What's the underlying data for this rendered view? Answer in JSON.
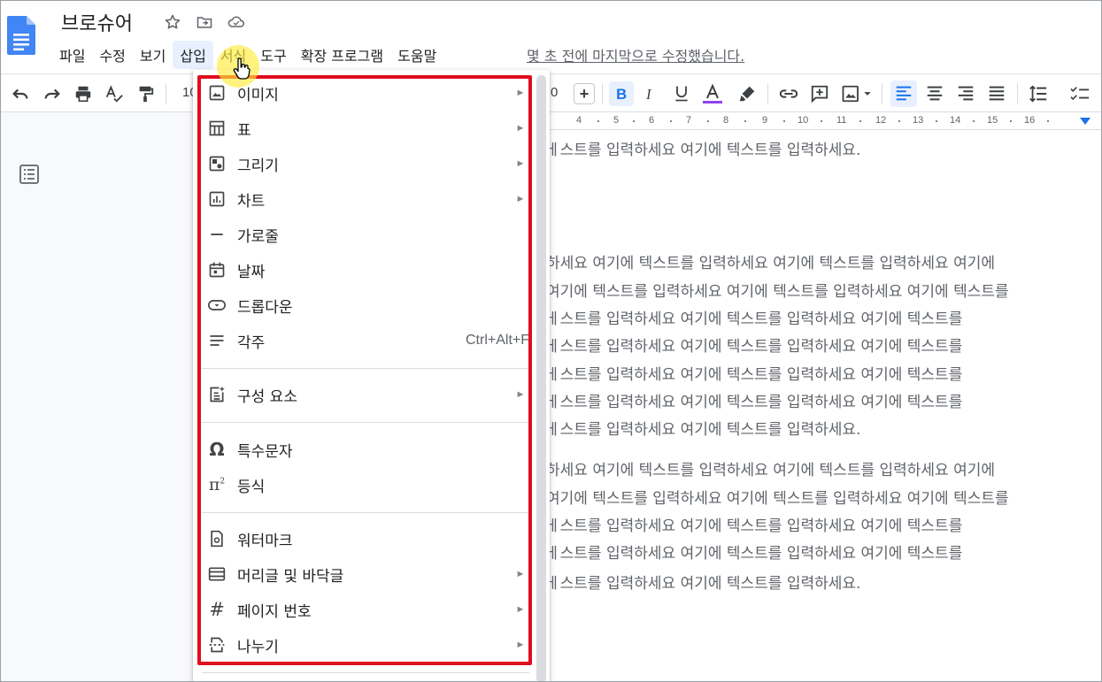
{
  "app": {
    "doc_title": "브로슈어",
    "last_edit": "몇 초 전에 마지막으로 수정했습니다."
  },
  "menubar": [
    "파일",
    "수정",
    "보기",
    "삽입",
    "서식",
    "도구",
    "확장 프로그램",
    "도움말"
  ],
  "toolbar": {
    "font_size_partial": "10",
    "font_size_tail": "0",
    "plus": "+",
    "text_color_accent": "#8e44ef"
  },
  "ruler": [
    "4",
    "5",
    "6",
    "7",
    "8",
    "9",
    "10",
    "11",
    "12",
    "13",
    "14",
    "15",
    "16"
  ],
  "document": {
    "lines": [
      "ㅔ스트를 입력하세요 여기에 텍스트를 입력하세요.",
      "하세요 여기에 텍스트를 입력하세요 여기에 텍스트를 입력하세요 여기에",
      "여기에 텍스트를 입력하세요 여기에 텍스트를 입력하세요 여기에 텍스트를",
      "ㅔ스트를 입력하세요 여기에 텍스트를 입력하세요 여기에 텍스트를",
      "ㅔ스트를 입력하세요 여기에 텍스트를 입력하세요 여기에 텍스트를",
      "ㅔ스트를 입력하세요 여기에 텍스트를 입력하세요 여기에 텍스트를",
      "ㅔ스트를 입력하세요 여기에 텍스트를 입력하세요 여기에 텍스트를",
      "ㅔ스트를 입력하세요 여기에 텍스트를 입력하세요.",
      "하세요 여기에 텍스트를 입력하세요 여기에 텍스트를 입력하세요 여기에",
      "여기에 텍스트를 입력하세요 여기에 텍스트를 입력하세요 여기에 텍스트를",
      "ㅔ스트를 입력하세요 여기에 텍스트를 입력하세요 여기에 텍스트를",
      "ㅔ스트를 입력하세요 여기에 텍스트를 입력하세요 여기에 텍스트를",
      "ㅔ스트를 입력하세요 여기에 텍스트를 입력하세요."
    ]
  },
  "insert_menu": {
    "items": [
      {
        "label": "이미지",
        "icon": "image-icon",
        "submenu": true
      },
      {
        "label": "표",
        "icon": "table-icon",
        "submenu": true
      },
      {
        "label": "그리기",
        "icon": "drawing-icon",
        "submenu": true
      },
      {
        "label": "차트",
        "icon": "chart-icon",
        "submenu": true
      },
      {
        "label": "가로줄",
        "icon": "horizontal-line-icon",
        "submenu": false
      },
      {
        "label": "날짜",
        "icon": "calendar-icon",
        "submenu": false
      },
      {
        "label": "드롭다운",
        "icon": "dropdown-icon",
        "submenu": false
      },
      {
        "label": "각주",
        "icon": "footnote-icon",
        "submenu": false,
        "shortcut": "Ctrl+Alt+F"
      },
      {
        "label": "구성 요소",
        "icon": "building-blocks-icon",
        "submenu": true
      },
      {
        "label": "특수문자",
        "icon": "omega-icon",
        "submenu": false
      },
      {
        "label": "등식",
        "icon": "pi-icon",
        "submenu": false
      },
      {
        "label": "워터마크",
        "icon": "watermark-icon",
        "submenu": false
      },
      {
        "label": "머리글 및 바닥글",
        "icon": "header-footer-icon",
        "submenu": true
      },
      {
        "label": "페이지 번호",
        "icon": "hash-icon",
        "submenu": true
      },
      {
        "label": "나누기",
        "icon": "break-icon",
        "submenu": true
      }
    ],
    "submenu_arrow": "►",
    "highlight_color": "#e00d1d"
  }
}
